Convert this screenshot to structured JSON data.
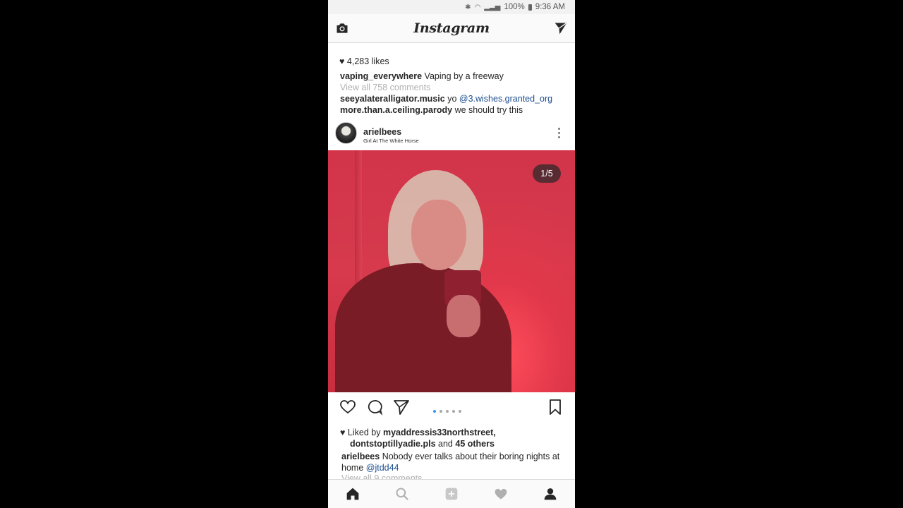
{
  "status_bar": {
    "battery": "100%",
    "time": "9:36 AM"
  },
  "app": {
    "title": "Instagram"
  },
  "previous_post": {
    "likes": "4,283 likes",
    "caption_user": "vaping_everywhere",
    "caption_text": "Vaping by a freeway",
    "view_comments": "View all 758 comments",
    "comments": [
      {
        "user": "seeyalateralligator.music",
        "text": "yo",
        "mention": "@3.wishes.granted_org"
      },
      {
        "user": "more.than.a.ceiling.parody",
        "text": " we should try this"
      }
    ]
  },
  "post": {
    "username": "arielbees",
    "location": "Girl At The White Horse",
    "counter": "1/5",
    "carousel": {
      "count": 5,
      "active": 1
    },
    "liked_by_prefix": "Liked by",
    "liked_by_user1": "myaddressis33northstreet,",
    "liked_by_user2": "dontstoptillyadie.pls",
    "liked_by_and": "and",
    "liked_by_others": "45 others",
    "caption_user": "arielbees",
    "caption_text": "Nobody ever talks about their boring nights at home",
    "caption_mention": "@jtdd44",
    "view_comments": "View all 9 comments"
  },
  "icons": {
    "camera": "camera-icon",
    "direct": "direct-message-icon",
    "heart": "heart-icon",
    "comment": "comment-icon",
    "share": "share-icon",
    "bookmark": "bookmark-icon",
    "home": "home-icon",
    "search": "search-icon",
    "add": "add-post-icon",
    "activity": "activity-heart-icon",
    "profile": "profile-icon"
  },
  "colors": {
    "link": "#1d4f91",
    "active_dot": "#3897f0"
  }
}
